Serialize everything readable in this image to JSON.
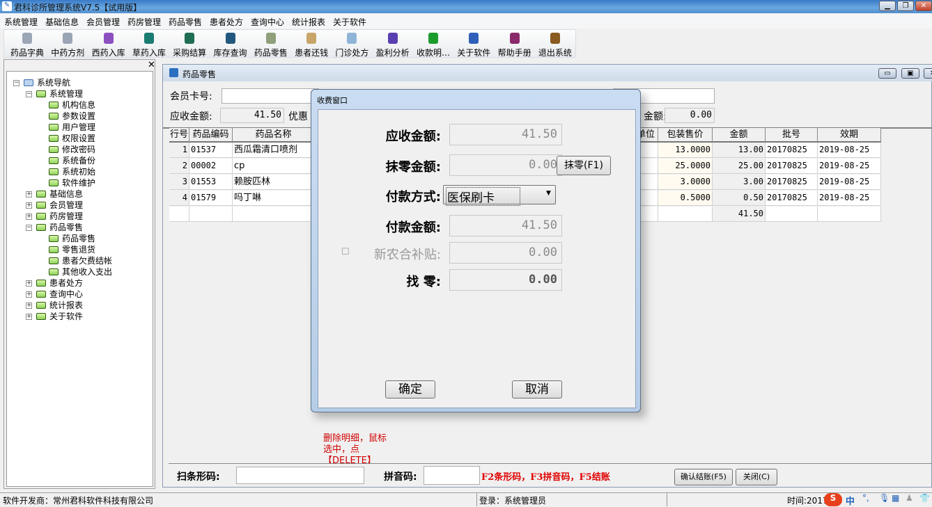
{
  "app": {
    "title": "君科诊所管理系统V7.5【试用版】"
  },
  "menu": [
    "系统管理",
    "基础信息",
    "会员管理",
    "药房管理",
    "药品零售",
    "患者处方",
    "查询中心",
    "统计报表",
    "关于软件"
  ],
  "toolbar": [
    {
      "label": "药品字典",
      "icon": "capsule-icon",
      "color": "#9aa6b5"
    },
    {
      "label": "中药方剂",
      "icon": "capsule-icon",
      "color": "#9aa6b5"
    },
    {
      "label": "西药入库",
      "icon": "medicine-box-icon",
      "color": "#8c4fc0"
    },
    {
      "label": "草药入库",
      "icon": "jar-icon",
      "color": "#1b7c72"
    },
    {
      "label": "采购结算",
      "icon": "calculator-icon",
      "color": "#1f6d52"
    },
    {
      "label": "库存查询",
      "icon": "warehouse-icon",
      "color": "#23577d"
    },
    {
      "label": "药品零售",
      "icon": "money-bag-icon",
      "color": "#8fa07a"
    },
    {
      "label": "患者还钱",
      "icon": "hand-coins-icon",
      "color": "#c9a56a"
    },
    {
      "label": "门诊处方",
      "icon": "prescription-icon",
      "color": "#8fb4d8"
    },
    {
      "label": "盈利分析",
      "icon": "bar-chart-icon",
      "color": "#5a3fb0"
    },
    {
      "label": "收款明…",
      "icon": "dollar-bag-icon",
      "color": "#1c9c2c"
    },
    {
      "label": "关于软件",
      "icon": "help-icon",
      "color": "#2f5fb8"
    },
    {
      "label": "帮助手册",
      "icon": "book-icon",
      "color": "#8a2a6a"
    },
    {
      "label": "退出系统",
      "icon": "exit-door-icon",
      "color": "#8a5a20"
    }
  ],
  "sidebar": {
    "close": "✕",
    "tree": [
      {
        "label": "系统导航",
        "depth": 0,
        "expanded": true,
        "root": true
      },
      {
        "label": "系统管理",
        "depth": 1,
        "expanded": true
      },
      {
        "label": "机构信息",
        "depth": 2
      },
      {
        "label": "参数设置",
        "depth": 2
      },
      {
        "label": "用户管理",
        "depth": 2
      },
      {
        "label": "权限设置",
        "depth": 2
      },
      {
        "label": "修改密码",
        "depth": 2
      },
      {
        "label": "系统备份",
        "depth": 2
      },
      {
        "label": "系统初始",
        "depth": 2
      },
      {
        "label": "软件维护",
        "depth": 2
      },
      {
        "label": "基础信息",
        "depth": 1,
        "expanded": false
      },
      {
        "label": "会员管理",
        "depth": 1,
        "expanded": false
      },
      {
        "label": "药房管理",
        "depth": 1,
        "expanded": false
      },
      {
        "label": "药品零售",
        "depth": 1,
        "expanded": true
      },
      {
        "label": "药品零售",
        "depth": 2,
        "selected": true
      },
      {
        "label": "零售退货",
        "depth": 2
      },
      {
        "label": "患者欠费结帐",
        "depth": 2
      },
      {
        "label": "其他收入支出",
        "depth": 2
      },
      {
        "label": "患者处方",
        "depth": 1,
        "expanded": false
      },
      {
        "label": "查询中心",
        "depth": 1,
        "expanded": false
      },
      {
        "label": "统计报表",
        "depth": 1,
        "expanded": false
      },
      {
        "label": "关于软件",
        "depth": 1,
        "expanded": false
      }
    ]
  },
  "retail": {
    "title": "药品零售",
    "member_label": "会员卡号:",
    "member_value": "",
    "receivable_label": "应收金额:",
    "receivable_value": "41.50",
    "discount_label": "优惠",
    "right_amount_label": "金额:",
    "right_amount_value": "0.00",
    "columns": [
      "行号",
      "药品编码",
      "药品名称",
      "",
      "单位",
      "包装售价",
      "金额",
      "批号",
      "效期"
    ],
    "rows": [
      {
        "no": "1",
        "code": "01537",
        "name": "西瓜霜清口喷剂",
        "price": "13.0000",
        "amount": "13.00",
        "batch": "20170825",
        "expiry": "2019-08-25"
      },
      {
        "no": "2",
        "code": "00002",
        "name": "cp",
        "price": "25.0000",
        "amount": "25.00",
        "batch": "20170825",
        "expiry": "2019-08-25"
      },
      {
        "no": "3",
        "code": "01553",
        "name": "赖胺匹林",
        "price": "3.0000",
        "amount": "3.00",
        "batch": "20170825",
        "expiry": "2019-08-25"
      },
      {
        "no": "4",
        "code": "01579",
        "name": "吗丁啉",
        "price": "0.5000",
        "amount": "0.50",
        "batch": "20170825",
        "expiry": "2019-08-25"
      }
    ],
    "total": "41.50",
    "delete_hint": "删除明细，鼠标选中，点【DELETE】",
    "barcode_label": "扫条形码:",
    "barcode_value": "",
    "pinyin_label": "拼音码:",
    "pinyin_value": "",
    "shortcut_hint": "F2条形码，F3拼音码，F5结账",
    "confirm_button": "确认结账(F5)",
    "close_button": "关闭(C)"
  },
  "dialog": {
    "title": "收费窗口",
    "receivable_label": "应收金额:",
    "receivable_value": "41.50",
    "rounding_label": "抹零金额:",
    "rounding_value": "0.00",
    "rounding_button": "抹零(F1)",
    "payment_method_label": "付款方式:",
    "payment_method_value": "医保刷卡",
    "paid_label": "付款金额:",
    "paid_value": "41.50",
    "subsidy_label": "新农合补贴:",
    "subsidy_checked": false,
    "subsidy_value": "0.00",
    "change_label": "找    零:",
    "change_value": "0.00",
    "ok_button": "确定",
    "cancel_button": "取消"
  },
  "status": {
    "developer": "软件开发商：常州君科软件科技有限公司",
    "login": "登录：系统管理员",
    "time": "时间:2017",
    "ime": "中"
  }
}
